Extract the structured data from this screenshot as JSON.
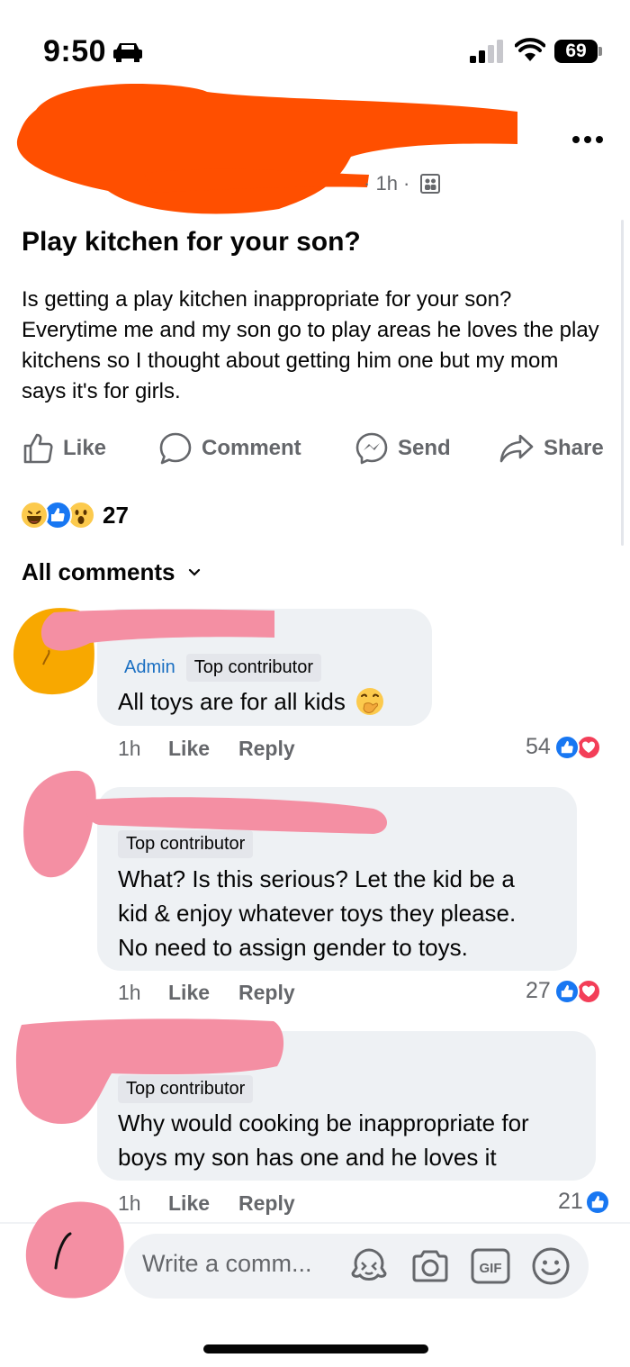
{
  "status_bar": {
    "time": "9:50",
    "battery": "69"
  },
  "post": {
    "time": "1h",
    "title": "Play kitchen for your son?",
    "body": "Is getting a play kitchen inappropriate for your son? Everytime me and my son go to play areas he loves the play kitchens so I thought about getting him one but my mom says it's for girls.",
    "actions": {
      "like": "Like",
      "comment": "Comment",
      "send": "Send",
      "share": "Share"
    },
    "reaction_count": "27",
    "reactions": [
      "laugh",
      "like",
      "wow"
    ]
  },
  "comments_header": "All comments",
  "comments": [
    {
      "admin_label": "Admin",
      "badge": "Top contributor",
      "text": "All toys are for all kids",
      "emoji": "face-with-hand-over-mouth",
      "time": "1h",
      "like": "Like",
      "reply": "Reply",
      "reaction_count": "54",
      "reactions": [
        "like",
        "love"
      ]
    },
    {
      "badge": "Top contributor",
      "text_lines": [
        "What? Is this serious? Let the kid be a",
        "kid & enjoy whatever toys they please.",
        "No need to assign gender to toys."
      ],
      "time": "1h",
      "like": "Like",
      "reply": "Reply",
      "reaction_count": "27",
      "reactions": [
        "like",
        "love"
      ]
    },
    {
      "badge": "Top contributor",
      "text_lines": [
        "Why would cooking be inappropriate for",
        "boys my son has one and he loves it"
      ],
      "time": "1h",
      "like": "Like",
      "reply": "Reply",
      "reaction_count": "21",
      "reactions": [
        "like"
      ]
    }
  ],
  "composer": {
    "placeholder": "Write a comm...",
    "icons": [
      "avatar-sticker-icon",
      "camera-icon",
      "gif-icon",
      "emoji-icon"
    ]
  },
  "colors": {
    "accent": "#1877f2",
    "redact_orange": "#ff4f00",
    "redact_pink": "#f48fa3",
    "text_secondary": "#65676b",
    "bubble": "#eef1f4"
  }
}
